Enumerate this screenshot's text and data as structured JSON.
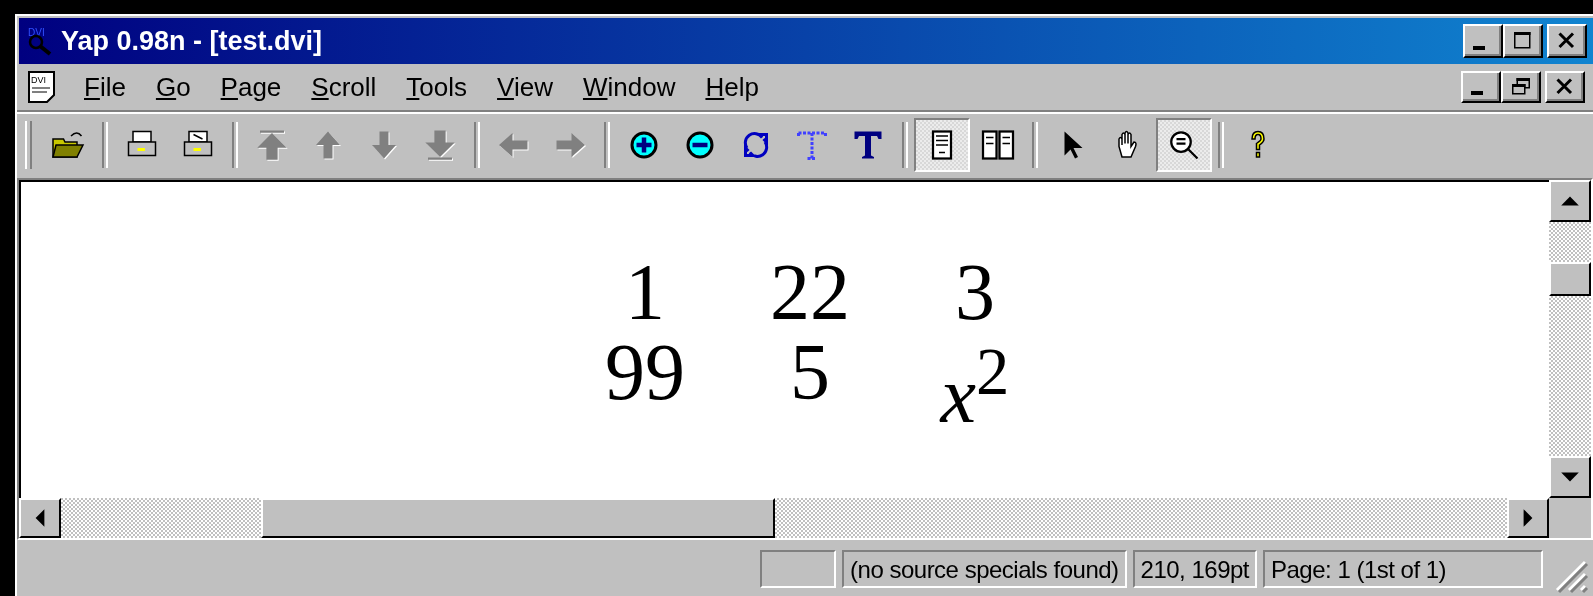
{
  "window": {
    "title": "Yap 0.98n - [test.dvi]",
    "icon_label": "DVI"
  },
  "menu_bar": {
    "icon_label": "DVI",
    "items": [
      {
        "label": "File"
      },
      {
        "label": "Go"
      },
      {
        "label": "Page"
      },
      {
        "label": "Scroll"
      },
      {
        "label": "Tools"
      },
      {
        "label": "View"
      },
      {
        "label": "Window"
      },
      {
        "label": "Help"
      }
    ]
  },
  "toolbar": {
    "groups": [
      [
        {
          "kind": "open",
          "disabled": false,
          "pressed": false
        }
      ],
      [
        {
          "kind": "print",
          "disabled": false,
          "pressed": false
        },
        {
          "kind": "print-setup",
          "disabled": false,
          "pressed": false
        }
      ],
      [
        {
          "kind": "first",
          "disabled": true,
          "pressed": false
        },
        {
          "kind": "up",
          "disabled": true,
          "pressed": false
        },
        {
          "kind": "down",
          "disabled": true,
          "pressed": false
        },
        {
          "kind": "last",
          "disabled": true,
          "pressed": false
        }
      ],
      [
        {
          "kind": "back",
          "disabled": true,
          "pressed": false
        },
        {
          "kind": "forward",
          "disabled": true,
          "pressed": false
        }
      ],
      [
        {
          "kind": "zoom-in",
          "disabled": false,
          "pressed": false
        },
        {
          "kind": "zoom-out",
          "disabled": false,
          "pressed": false
        },
        {
          "kind": "refresh",
          "disabled": false,
          "pressed": false
        },
        {
          "kind": "text-outline",
          "disabled": false,
          "pressed": false
        },
        {
          "kind": "text",
          "disabled": false,
          "pressed": false
        }
      ],
      [
        {
          "kind": "single-page",
          "disabled": false,
          "pressed": true
        },
        {
          "kind": "double-page",
          "disabled": false,
          "pressed": false
        }
      ],
      [
        {
          "kind": "pointer",
          "disabled": false,
          "pressed": false
        },
        {
          "kind": "hand",
          "disabled": false,
          "pressed": false
        },
        {
          "kind": "magnifier",
          "disabled": false,
          "pressed": true
        }
      ],
      [
        {
          "kind": "help",
          "disabled": false,
          "pressed": false
        }
      ]
    ]
  },
  "document": {
    "rows": [
      [
        "1",
        "22",
        "3"
      ],
      [
        "99",
        "5",
        "*x*$^{2}$"
      ]
    ]
  },
  "status_bar": {
    "panels": [
      "(no source specials found)",
      "210, 169pt",
      "Page: 1 (1st of 1)"
    ]
  }
}
